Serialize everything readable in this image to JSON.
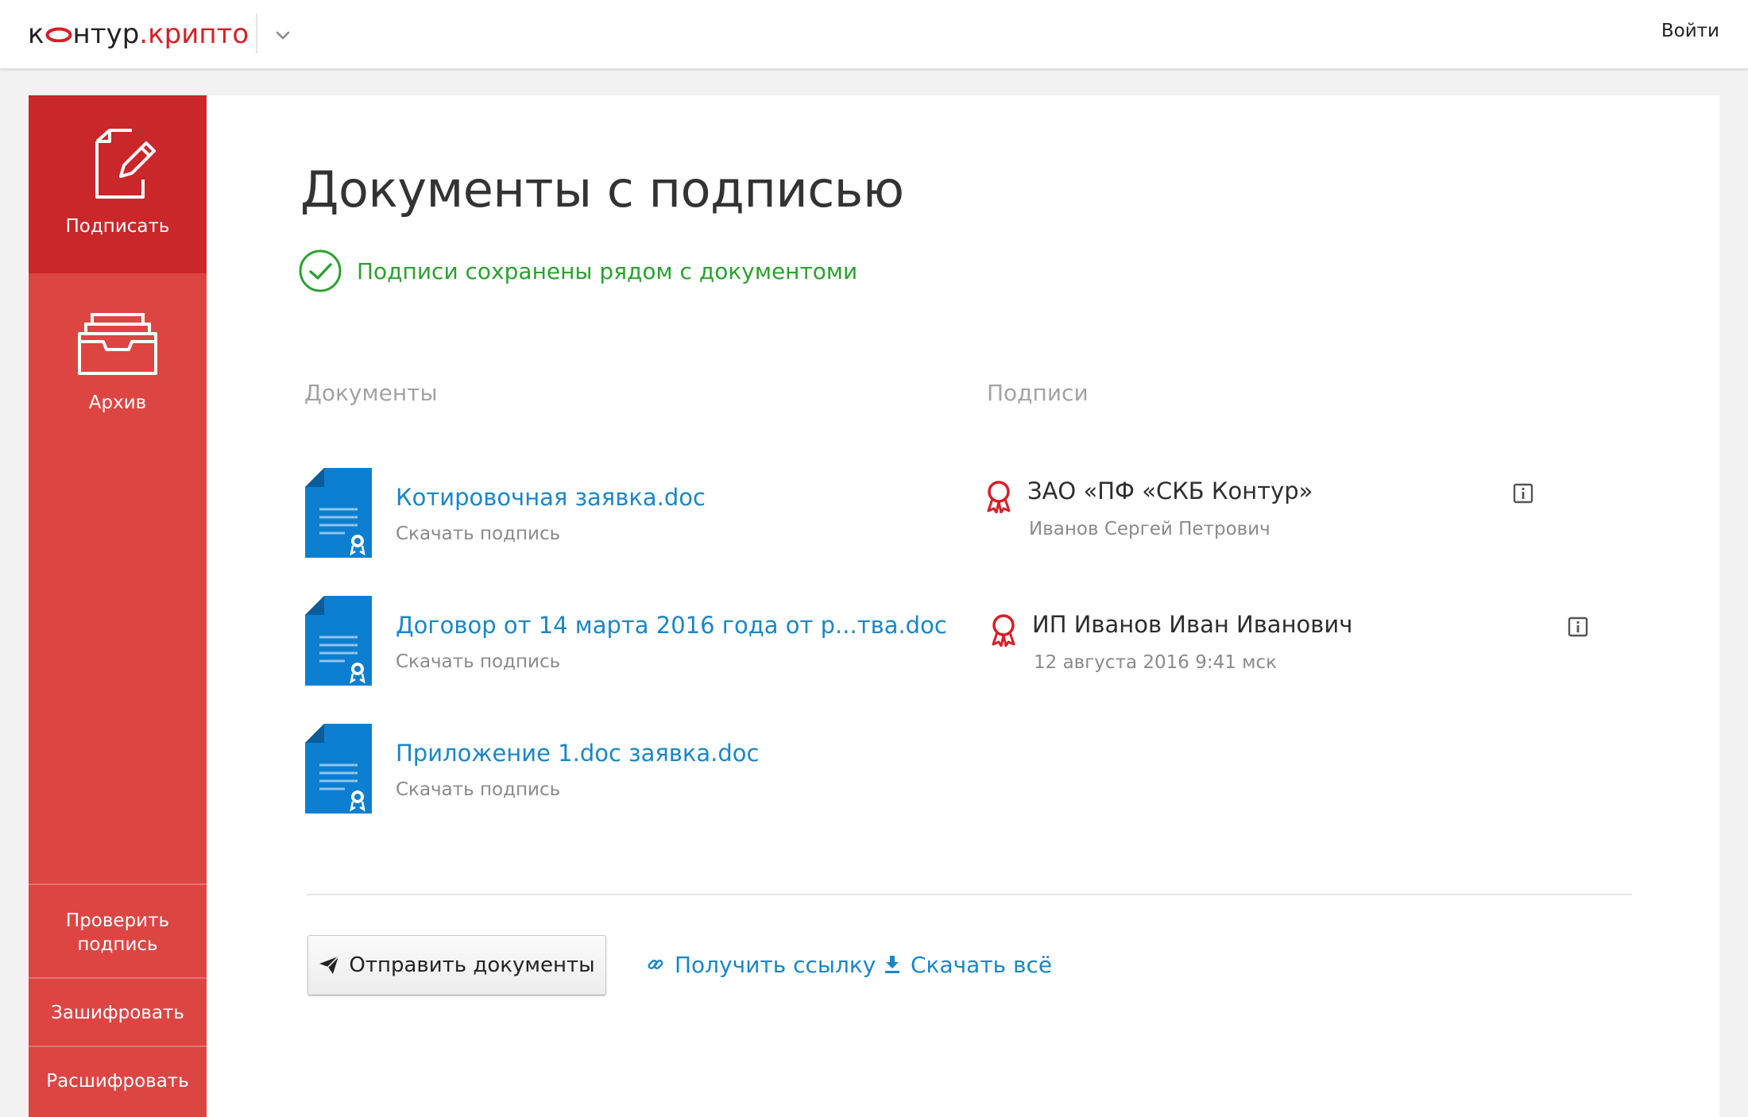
{
  "header": {
    "logo_prefix": "к",
    "logo_middle": "нтур",
    "logo_suffix": ".крипто",
    "login_label": "Войти"
  },
  "sidebar": {
    "sign_label": "Подписать",
    "archive_label": "Архив",
    "verify_label_line1": "Проверить",
    "verify_label_line2": "подпись",
    "encrypt_label": "Зашифровать",
    "decrypt_label": "Расшифровать"
  },
  "main": {
    "title": "Документы с подписью",
    "success_message": "Подписи сохранены рядом с документоми",
    "documents_header": "Документы",
    "signatures_header": "Подписи",
    "documents": [
      {
        "name": "Котировочная заявка.doc",
        "action": "Скачать подпись"
      },
      {
        "name": "Договор от 14 марта 2016 года от р...тва.doc",
        "action": "Скачать подпись"
      },
      {
        "name": "Приложение 1.doc заявка.doc",
        "action": "Скачать подпись"
      }
    ],
    "signatures": [
      {
        "name": "ЗАО «ПФ «СКБ Контур»",
        "detail": "Иванов Сергей Петрович"
      },
      {
        "name": "ИП Иванов Иван Иванович",
        "detail": "12 августа 2016  9:41 мск"
      }
    ],
    "actions": {
      "send_label": "Отправить документы",
      "get_link_label": "Получить ссылку",
      "download_all_label": "Скачать всё"
    }
  },
  "colors": {
    "brand_red": "#c9272a",
    "sidebar_red": "#dd4543",
    "link_blue": "#1a86c8",
    "success_green": "#2aa12f",
    "doc_icon_blue": "#0d7fd1"
  }
}
